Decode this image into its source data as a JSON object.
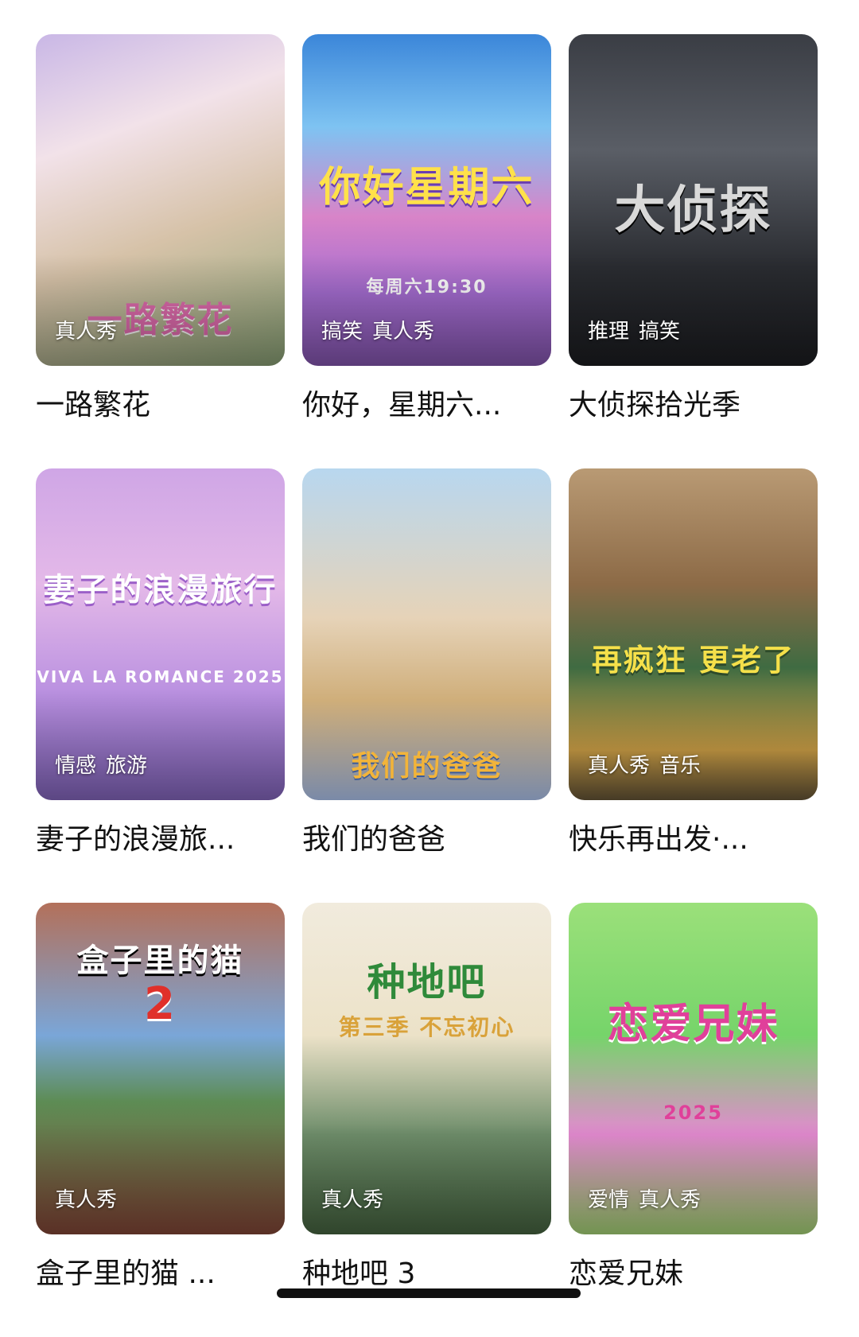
{
  "cards": [
    {
      "title": "一路繁花",
      "tags": [
        "真人秀"
      ],
      "poster_text": "一路繁花",
      "accent": "#c9b7e6"
    },
    {
      "title": "你好，星期六...",
      "tags": [
        "搞笑",
        "真人秀"
      ],
      "poster_text": "你好星期六",
      "poster_sub": "每周六19:30",
      "accent": "#3b86d9"
    },
    {
      "title": "大侦探拾光季",
      "tags": [
        "推理",
        "搞笑"
      ],
      "poster_text": "大侦探",
      "accent": "#3a3d44"
    },
    {
      "title": "妻子的浪漫旅...",
      "tags": [
        "情感",
        "旅游"
      ],
      "poster_text": "妻子的浪漫旅行",
      "poster_sub": "VIVA LA ROMANCE 2025",
      "accent": "#cfa6e6"
    },
    {
      "title": "我们的爸爸",
      "tags": [],
      "poster_text": "我们的爸爸",
      "accent": "#b8d7ef"
    },
    {
      "title": "快乐再出发·...",
      "tags": [
        "真人秀",
        "音乐"
      ],
      "poster_text": "再疯狂 更老了",
      "accent": "#b99a74"
    },
    {
      "title": "盒子里的猫 ...",
      "tags": [
        "真人秀"
      ],
      "poster_text": "盒子里的猫",
      "poster_sub": "2",
      "accent": "#b3705a"
    },
    {
      "title": "种地吧 3",
      "tags": [
        "真人秀"
      ],
      "poster_text": "种地吧",
      "poster_sub": "第三季 不忘初心",
      "accent": "#f1ebdd"
    },
    {
      "title": "恋爱兄妹",
      "tags": [
        "爱情",
        "真人秀"
      ],
      "poster_text": "恋爱兄妹",
      "poster_sub": "2025",
      "accent": "#9be07a"
    }
  ]
}
